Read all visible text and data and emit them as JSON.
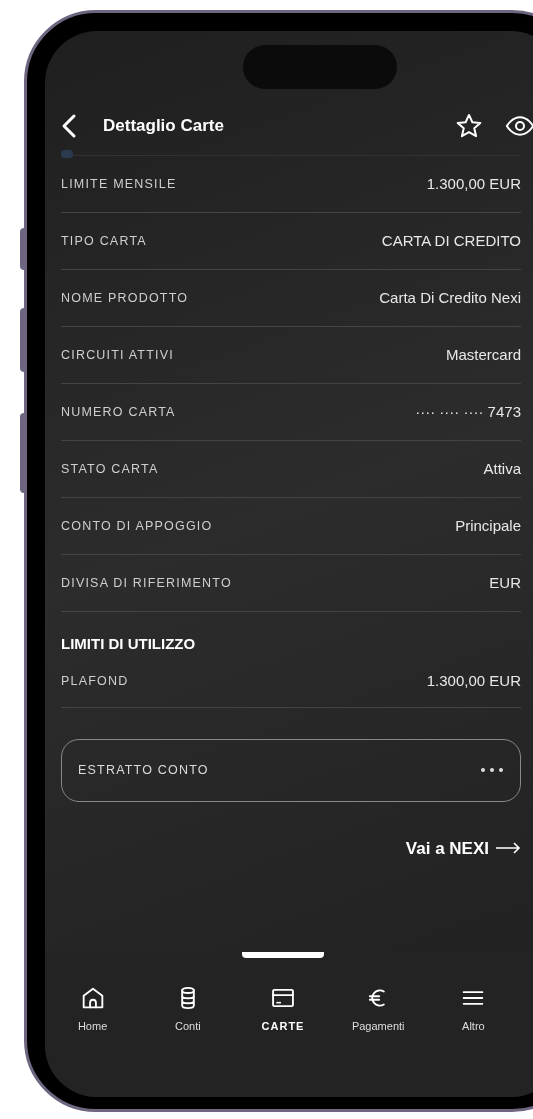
{
  "header": {
    "title": "Dettaglio Carte"
  },
  "details": [
    {
      "label": "LIMITE MENSILE",
      "value": "1.300,00 EUR"
    },
    {
      "label": "TIPO CARTA",
      "value": "CARTA DI CREDITO"
    },
    {
      "label": "NOME PRODOTTO",
      "value": "Carta Di Credito Nexi"
    },
    {
      "label": "CIRCUITI ATTIVI",
      "value": "Mastercard"
    },
    {
      "label": "NUMERO CARTA",
      "value": "···· ···· ···· 7473"
    },
    {
      "label": "STATO CARTA",
      "value": "Attiva"
    },
    {
      "label": "CONTO DI APPOGGIO",
      "value": "Principale"
    },
    {
      "label": "DIVISA DI RIFERIMENTO",
      "value": "EUR"
    }
  ],
  "limits": {
    "title": "LIMITI DI UTILIZZO",
    "rows": [
      {
        "label": "PLAFOND",
        "value": "1.300,00 EUR"
      }
    ]
  },
  "statement": {
    "label": "ESTRATTO CONTO"
  },
  "link": {
    "label": "Vai a NEXI"
  },
  "nav": [
    {
      "label": "Home",
      "selected": false
    },
    {
      "label": "Conti",
      "selected": false
    },
    {
      "label": "CARTE",
      "selected": true
    },
    {
      "label": "Pagamenti",
      "selected": false
    },
    {
      "label": "Altro",
      "selected": false
    }
  ]
}
